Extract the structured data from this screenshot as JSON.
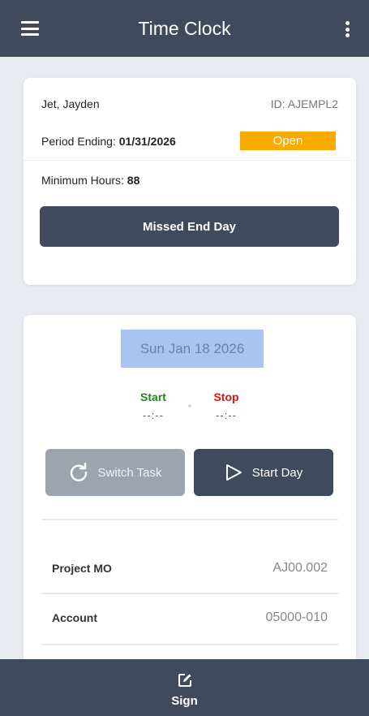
{
  "header": {
    "title": "Time Clock",
    "menu_icon": "hamburger-menu-icon",
    "more_icon": "more-vertical-icon"
  },
  "employee_card": {
    "name": "Jet, Jayden",
    "id_text": "ID: AJEMPL2",
    "period_label": "Period Ending:",
    "period_value": "01/31/2026",
    "status_badge": "Open",
    "min_hours_label": "Minimum Hours:",
    "min_hours_value": "88",
    "missed_button": "Missed End Day"
  },
  "day_card": {
    "date": "Sun Jan 18 2026",
    "start_label": "Start",
    "start_value": "--:--",
    "stop_label": "Stop",
    "stop_value": "--:--",
    "switch_task_button": "Switch Task",
    "start_day_button": "Start Day",
    "fields": [
      {
        "key": "Project MO",
        "value": "AJ00.002"
      },
      {
        "key": "Account",
        "value": "05000-010"
      }
    ]
  },
  "footer": {
    "sign_label": "Sign",
    "sign_icon": "edit-square-icon"
  },
  "colors": {
    "primary": "#3f4a5c",
    "badge": "#f9ab00",
    "start": "#1a8a1a",
    "stop": "#e01010",
    "date_highlight": "#a9c4f0"
  }
}
